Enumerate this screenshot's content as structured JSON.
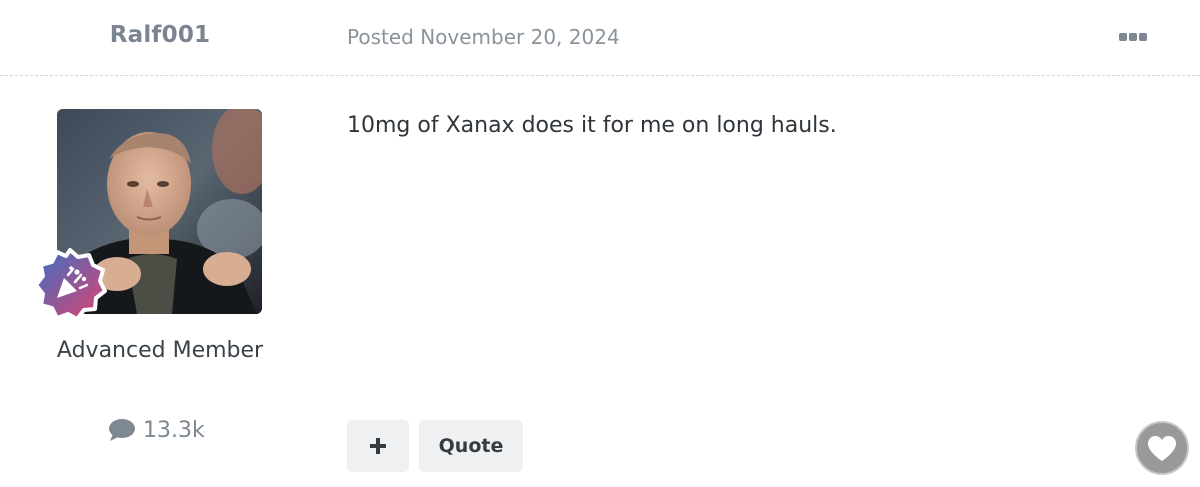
{
  "post": {
    "author_name": "Ralf001",
    "posted_label": "Posted November 20, 2024",
    "content": "10mg of Xanax does it for me on long hauls."
  },
  "author": {
    "member_group": "Advanced Member",
    "post_count": "13.3k",
    "avatar_icon": "user-photo",
    "rank_badge_icon": "party-popper-icon"
  },
  "actions": {
    "menu_icon": "ellipsis-icon",
    "multiquote_label": "+",
    "quote_label": "Quote",
    "react_icon": "heart-icon"
  },
  "colors": {
    "author_name": "#7b8591",
    "meta_text": "#8a939c",
    "button_bg": "#eef0f2",
    "react_bg": "#999999",
    "badge_gradient_start": "#3a6fc4",
    "badge_gradient_end": "#e0436f"
  }
}
